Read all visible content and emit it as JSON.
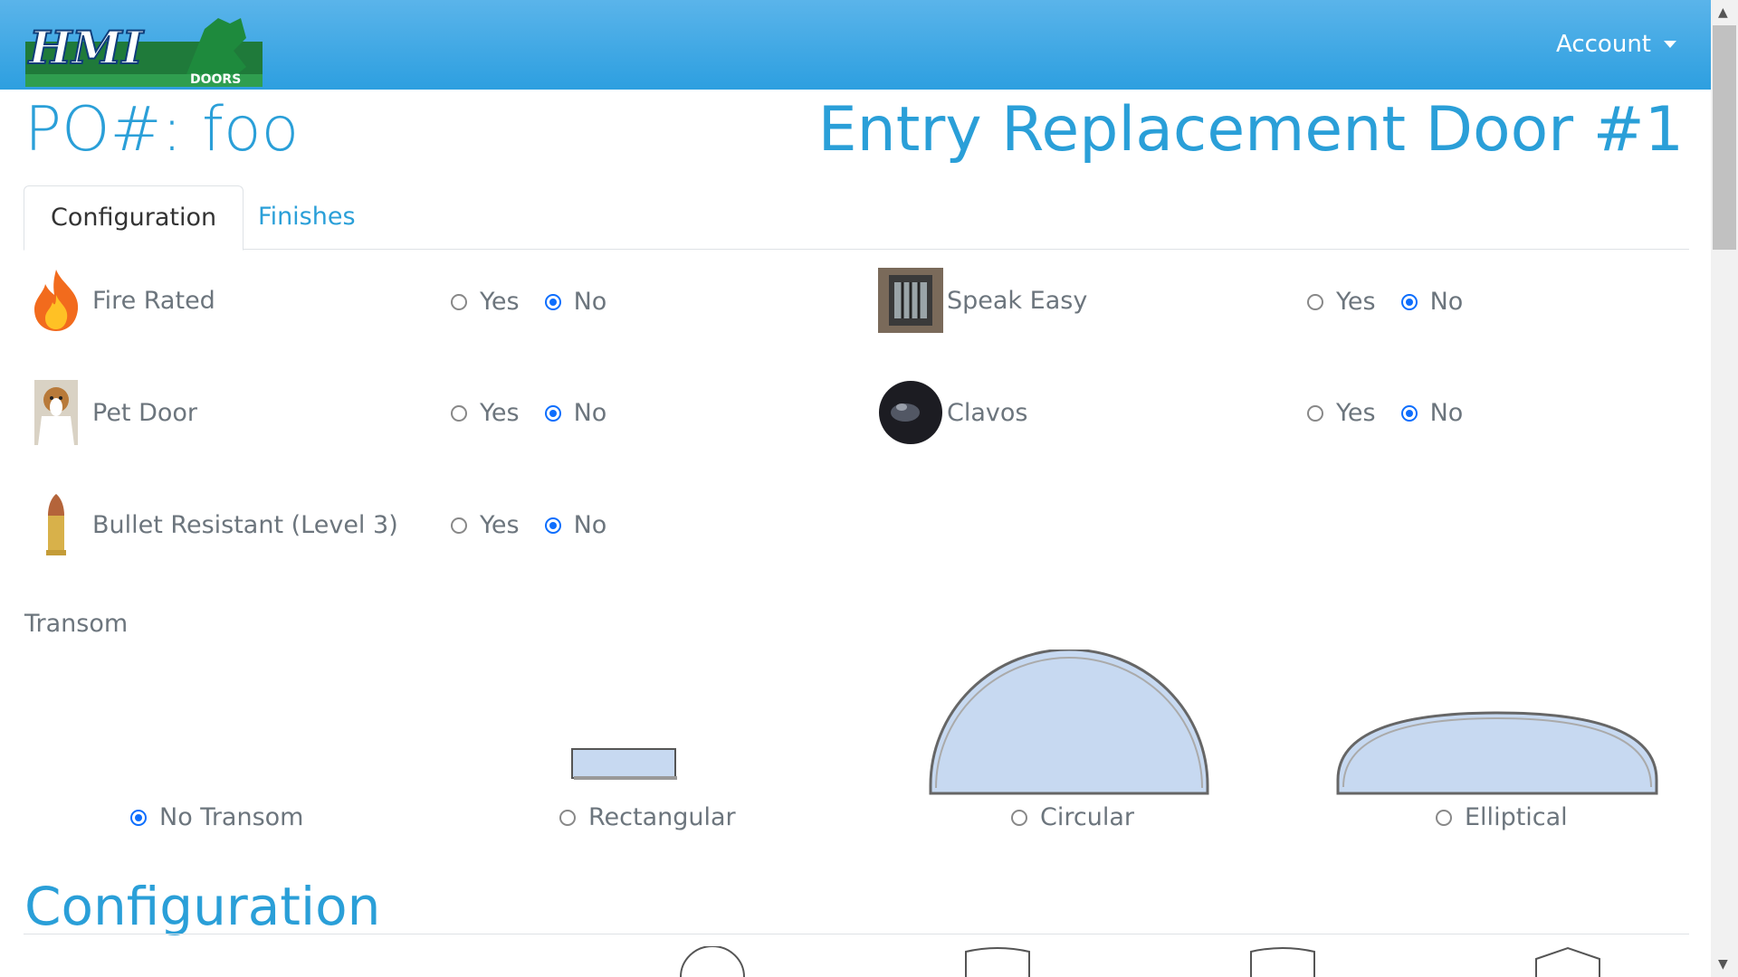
{
  "navbar": {
    "logo_text": "HMI",
    "logo_subtext": "DOORS",
    "account_label": "Account",
    "colors": {
      "bar": "#2d9fe0",
      "accent": "#2a9fd8",
      "radio_selected": "#0d6efd"
    }
  },
  "header": {
    "po_label": "PO#: foo",
    "door_title": "Entry Replacement Door #1"
  },
  "tabs": [
    {
      "label": "Configuration",
      "active": true
    },
    {
      "label": "Finishes",
      "active": false
    }
  ],
  "options": [
    {
      "label": "Fire Rated",
      "icon": "fire-icon",
      "yes": "Yes",
      "no": "No",
      "selected": "No"
    },
    {
      "label": "Speak Easy",
      "icon": "speak-easy-grille-icon",
      "yes": "Yes",
      "no": "No",
      "selected": "No"
    },
    {
      "label": "Pet Door",
      "icon": "dog-icon",
      "yes": "Yes",
      "no": "No",
      "selected": "No"
    },
    {
      "label": "Clavos",
      "icon": "clavo-icon",
      "yes": "Yes",
      "no": "No",
      "selected": "No"
    },
    {
      "label": "Bullet Resistant (Level 3)",
      "icon": "bullet-icon",
      "yes": "Yes",
      "no": "No",
      "selected": "No"
    }
  ],
  "transom": {
    "heading": "Transom",
    "choices": [
      {
        "label": "No Transom",
        "selected": true
      },
      {
        "label": "Rectangular",
        "selected": false
      },
      {
        "label": "Circular",
        "selected": false
      },
      {
        "label": "Elliptical",
        "selected": false
      }
    ]
  },
  "configuration": {
    "heading": "Configuration"
  }
}
